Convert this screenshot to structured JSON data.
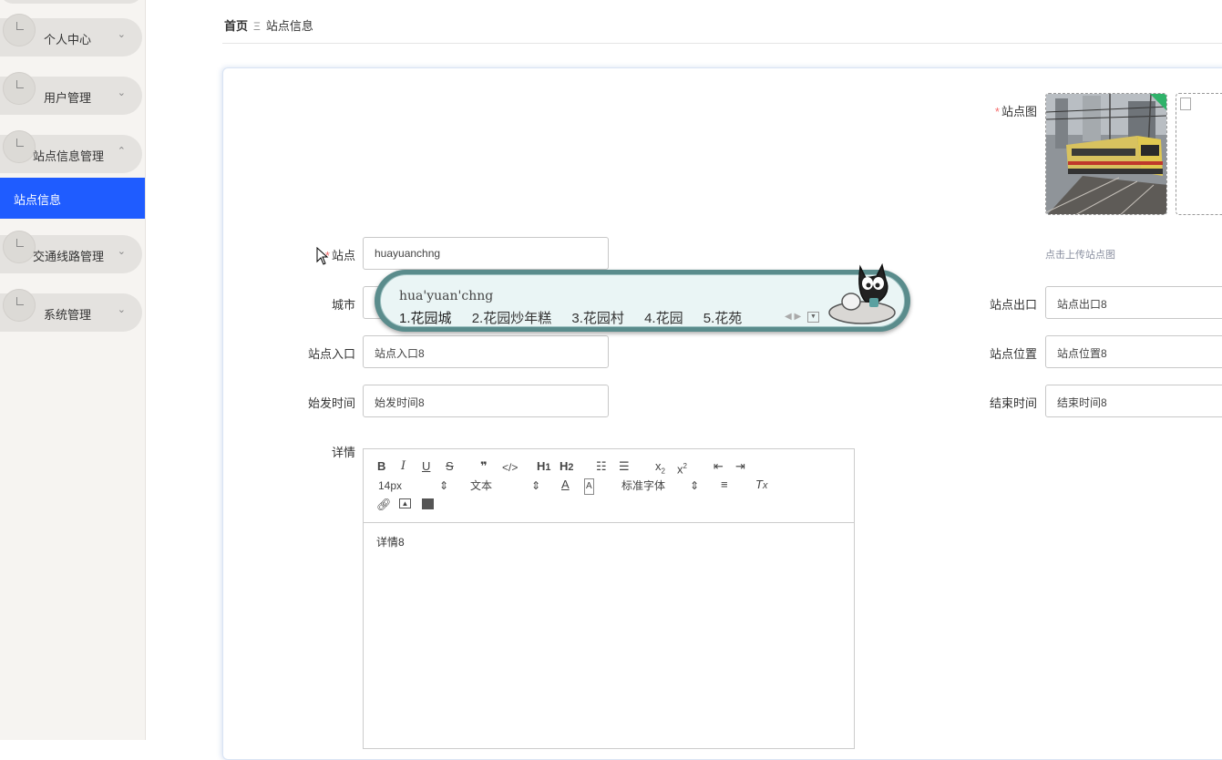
{
  "sidebar": {
    "items": [
      {
        "label": "个人中心",
        "chevron": "⌄"
      },
      {
        "label": "用户管理",
        "chevron": "⌄"
      },
      {
        "label": "站点信息管理",
        "chevron": "⌃"
      },
      {
        "label": "交通线路管理",
        "chevron": "⌄"
      },
      {
        "label": "系统管理",
        "chevron": "⌄"
      }
    ],
    "active_sub": "站点信息"
  },
  "breadcrumb": {
    "home": "首页",
    "sep": "Ξ",
    "current": "站点信息"
  },
  "form": {
    "station_image_label": "站点图",
    "upload_hint": "点击上传站点图",
    "station_label": "站点",
    "station_value": "huayuanchng",
    "city_label": "城市",
    "exit_label": "站点出口",
    "exit_value": "站点出口8",
    "entrance_label": "站点入口",
    "entrance_value": "站点入口8",
    "location_label": "站点位置",
    "location_value": "站点位置8",
    "start_label": "始发时间",
    "start_value": "始发时间8",
    "end_label": "结束时间",
    "end_value": "结束时间8",
    "detail_label": "详情",
    "required_mark": "*"
  },
  "editor": {
    "font_size": "14px",
    "block_type": "文本",
    "font_family": "标准字体",
    "content": "详情8"
  },
  "ime": {
    "pinyin": "hua'yuan'chng",
    "candidates": [
      "1.花园城",
      "2.花园炒年糕",
      "3.花园村",
      "4.花园",
      "5.花苑"
    ]
  }
}
